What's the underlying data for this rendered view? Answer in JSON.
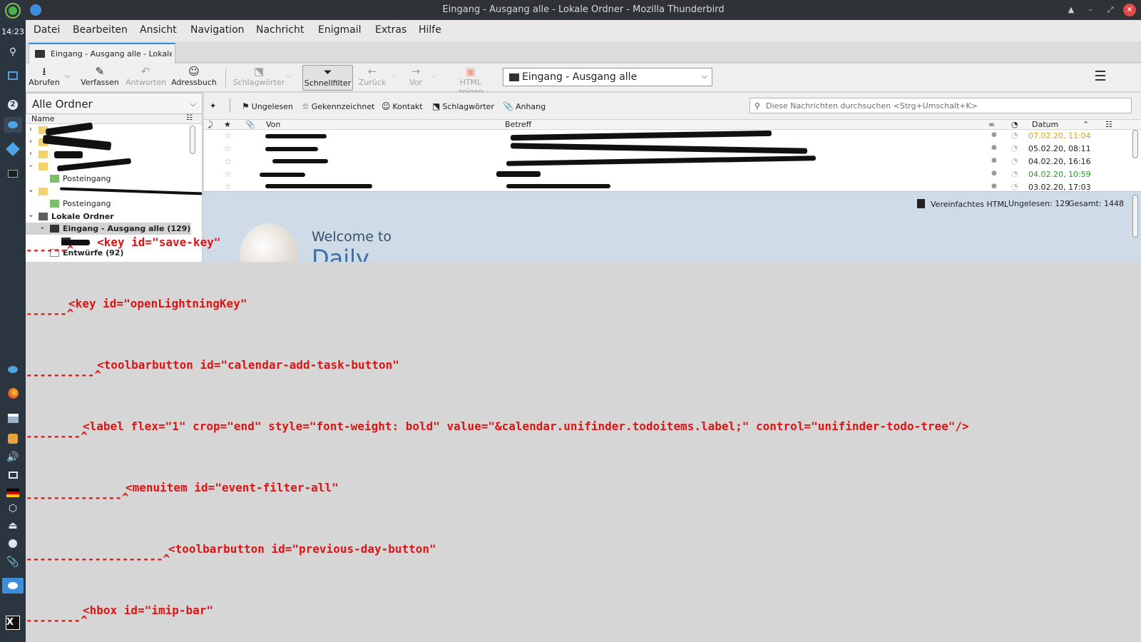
{
  "dock": {
    "clock": "14:23",
    "badge": "2",
    "items": [
      "app-menu-icon",
      "search-icon",
      "monitor-icon",
      "badge-icon",
      "thunderbird-icon",
      "compass-icon",
      "terminal-icon",
      "thunderbird-icon",
      "firefox-icon",
      "files-icon",
      "image-editor-icon",
      "volume-icon",
      "display-icon",
      "flag-de-icon",
      "package-icon",
      "eject-icon",
      "settings-icon",
      "paperclip-icon",
      "active-app-icon",
      "x-icon"
    ]
  },
  "window": {
    "title": "Eingang - Ausgang alle - Lokale Ordner - Mozilla Thunderbird"
  },
  "menubar": {
    "items": [
      "Datei",
      "Bearbeiten",
      "Ansicht",
      "Navigation",
      "Nachricht",
      "Enigmail",
      "Extras",
      "Hilfe"
    ]
  },
  "tab": {
    "label": "Eingang - Ausgang alle - Lokale O"
  },
  "toolbar": {
    "get": "Abrufen",
    "write": "Verfassen",
    "reply": "Antworten",
    "addressbook": "Adressbuch",
    "tags": "Schlagwörter",
    "quickfilter": "Schnellfilter",
    "back": "Zurück",
    "forward": "Vor",
    "html": "HTML zeigen",
    "folder_select": "Eingang - Ausgang alle"
  },
  "folderpane": {
    "mode": "Alle Ordner",
    "column": "Name",
    "rows": [
      {
        "label": ""
      },
      {
        "label": ""
      },
      {
        "label": ""
      },
      {
        "label": ""
      },
      {
        "label": "Posteingang"
      },
      {
        "label": ""
      },
      {
        "label": "Posteingang"
      },
      {
        "label": "Lokale Ordner"
      },
      {
        "label": "Eingang - Ausgang alle (129)"
      },
      {
        "label": ""
      },
      {
        "label": "Entwürfe (92)"
      }
    ]
  },
  "quickfilter": {
    "unread": "Ungelesen",
    "starred": "Gekennzeichnet",
    "contact": "Kontakt",
    "tags": "Schlagwörter",
    "attachment": "Anhang",
    "search_placeholder": "Diese Nachrichten durchsuchen <Strg+Umschalt+K>"
  },
  "threadpane": {
    "columns": {
      "from": "Von",
      "subject": "Betreff",
      "date": "Datum"
    },
    "rows": [
      {
        "date": "07.02.20, 11:04",
        "color": "#e8a200"
      },
      {
        "date": "05.02.20, 08:11",
        "color": "#222222"
      },
      {
        "date": "04.02.20, 16:16",
        "color": "#222222"
      },
      {
        "date": "04.02.20, 10:59",
        "color": "#1f9a1f"
      },
      {
        "date": "03.02.20, 17:03",
        "color": "#222222"
      }
    ]
  },
  "preview": {
    "simple_html": "Vereinfachtes HTML",
    "unread": "Ungelesen: 129",
    "total": "Gesamt: 1448",
    "welcome": "Welcome to",
    "daily": "Daily"
  },
  "errors": [
    {
      "code": "<key id=\"save-key\"",
      "marker": "------^"
    },
    {
      "code": "<key id=\"openLightningKey\"",
      "marker": "------^"
    },
    {
      "code": "<toolbarbutton id=\"calendar-add-task-button\"",
      "marker": "----------^"
    },
    {
      "code": "<label flex=\"1\" crop=\"end\" style=\"font-weight: bold\" value=\"&calendar.unifinder.todoitems.label;\" control=\"unifinder-todo-tree\"/>",
      "marker": "--------^"
    },
    {
      "code": "<menuitem id=\"event-filter-all\"",
      "marker": "--------------^"
    },
    {
      "code": "<toolbarbutton id=\"previous-day-button\"",
      "marker": "--------------------^"
    },
    {
      "code": "<hbox id=\"imip-bar\"",
      "marker": "--------^"
    }
  ],
  "colors": {
    "accent": "#2a8ee8",
    "error": "#dc1414",
    "preview_bg": "#cfdbe7"
  }
}
